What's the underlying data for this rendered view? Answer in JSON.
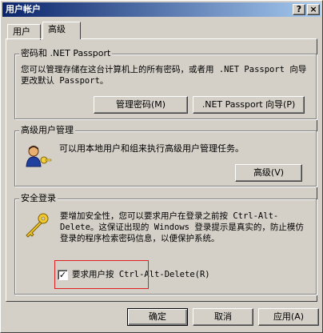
{
  "window": {
    "title": "用户帐户",
    "help_button": "?",
    "close_button": "×"
  },
  "tabs": [
    {
      "label": "用户"
    },
    {
      "label": "高级"
    }
  ],
  "passwords_group": {
    "legend": "密码和 .NET Passport",
    "description": "您可以管理存储在这台计算机上的所有密码，或者用 .NET Passport 向导更改默认 Passport。",
    "manage_button": "管理密码(M)",
    "wizard_button": ".NET Passport 向导(P)"
  },
  "advanced_user_group": {
    "legend": "高级用户管理",
    "description": "可以用本地用户和组来执行高级用户管理任务。",
    "advanced_button": "高级(V)",
    "icon": "users-key-icon"
  },
  "secure_logon_group": {
    "legend": "安全登录",
    "description": "要增加安全性，您可以要求用户在登录之前按 Ctrl-Alt-Delete。这保证出现的 Windows 登录提示是真实的，防止模仿登录的程序检索密码信息，以便保护系统。",
    "checkbox_label": "要求用户按 Ctrl-Alt-Delete(R)",
    "checkbox_checked": true,
    "icon": "key-icon"
  },
  "footer": {
    "ok_button": "确定",
    "cancel_button": "取消",
    "apply_button": "应用(A)"
  },
  "colors": {
    "title_start": "#0a246a",
    "title_end": "#a6caf0",
    "face": "#d4d0c8",
    "highlight": "#e02020"
  }
}
